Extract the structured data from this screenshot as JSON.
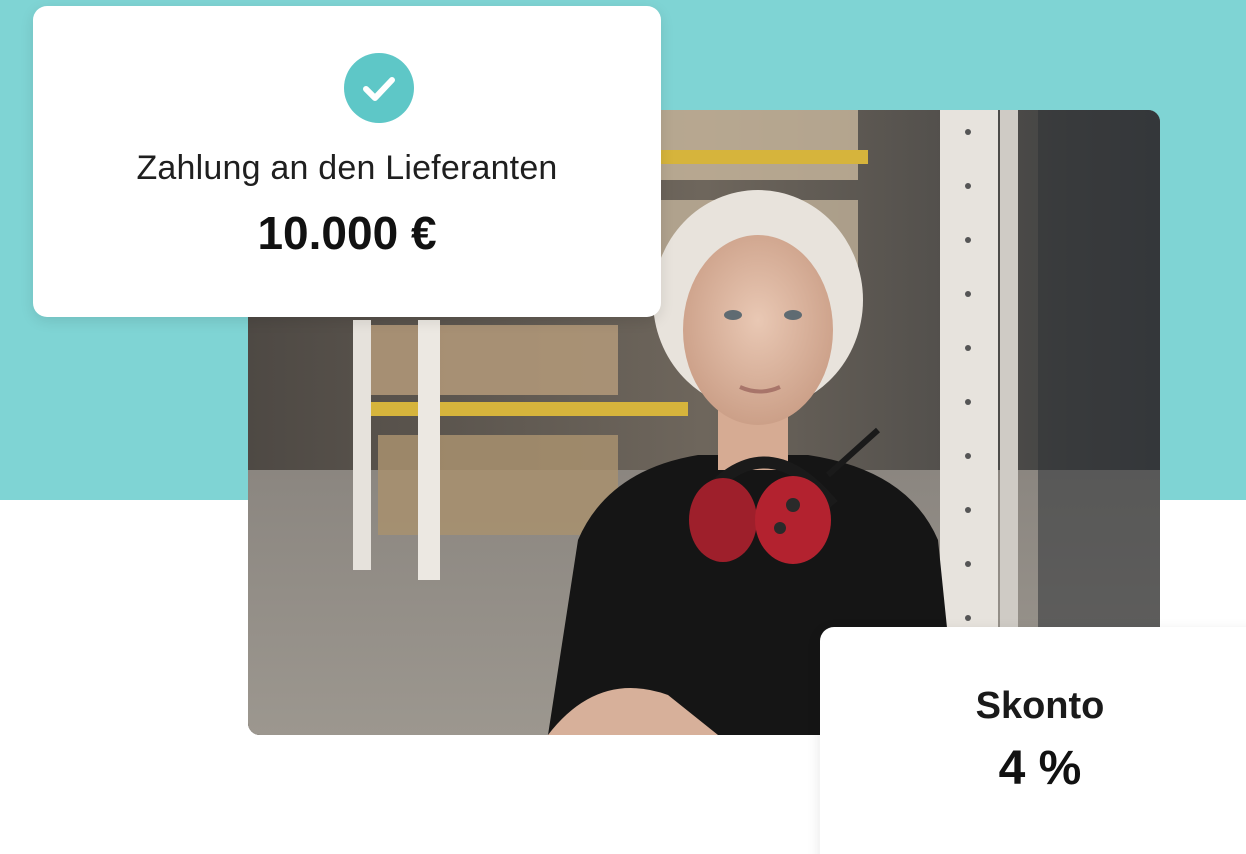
{
  "payment_card": {
    "icon": "check-icon",
    "label": "Zahlung an den Lieferanten",
    "amount": "10.000 €"
  },
  "skonto_card": {
    "label": "Skonto",
    "value": "4 %"
  },
  "photo": {
    "subject": "warehouse-worker-photo"
  },
  "colors": {
    "band": "#7fd4d4",
    "check": "#5ec7c7",
    "card": "#ffffff"
  }
}
